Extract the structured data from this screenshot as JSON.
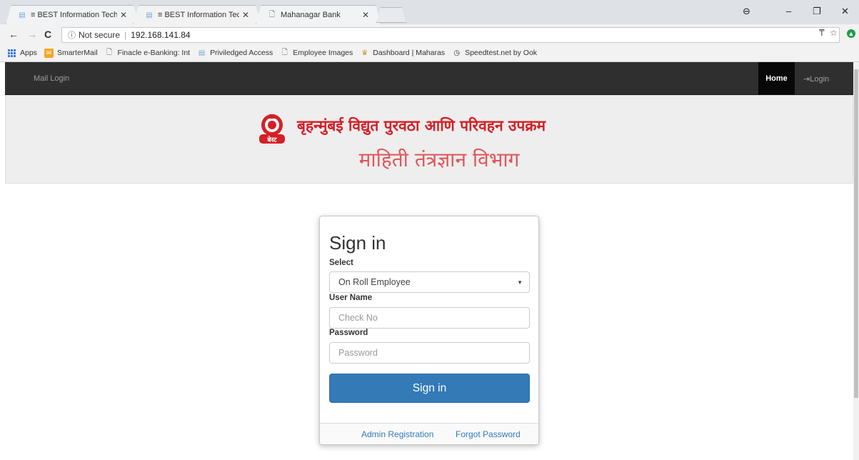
{
  "browser": {
    "tabs": [
      {
        "title": "≡ BEST Information Techn",
        "close": "✕"
      },
      {
        "title": "≡ BEST Information Techn",
        "close": "✕"
      },
      {
        "title": "Mahanagar Bank",
        "close": "✕"
      }
    ],
    "address": {
      "security": "Not secure",
      "url": "192.168.141.84"
    },
    "bookmarks": [
      {
        "label": "Apps",
        "icon": "apps-grid-icon"
      },
      {
        "label": "SmarterMail",
        "icon": "mail-icon"
      },
      {
        "label": "Finacle e-Banking: Int",
        "icon": "page-icon"
      },
      {
        "label": "Priviledged Access",
        "icon": "doc-icon"
      },
      {
        "label": "Employee Images",
        "icon": "page-icon"
      },
      {
        "label": "Dashboard | Maharas",
        "icon": "emblem-icon"
      },
      {
        "label": "Speedtest.net by Ook",
        "icon": "speedometer-icon"
      }
    ]
  },
  "navbar": {
    "brand": "Mail Login",
    "home": "Home",
    "login": "Login"
  },
  "banner": {
    "line1": "बृहन्मुंबई विद्युत पुरवठा आणि परिवहन उपक्रम",
    "line2": "माहिती तंत्रज्ञान विभाग",
    "logo_text": "बेस्ट"
  },
  "signin": {
    "heading": "Sign in",
    "select_label": "Select",
    "select_value": "On Roll Employee",
    "username_label": "User Name",
    "username_placeholder": "Check No",
    "password_label": "Password",
    "password_placeholder": "Password",
    "button": "Sign in",
    "admin_registration": "Admin Registration",
    "forgot_password": "Forgot Password"
  },
  "colors": {
    "navbar": "#2f2f2f",
    "primary_button": "#337ab7",
    "banner_red": "#d32027",
    "banner_pink": "#e0565a"
  }
}
